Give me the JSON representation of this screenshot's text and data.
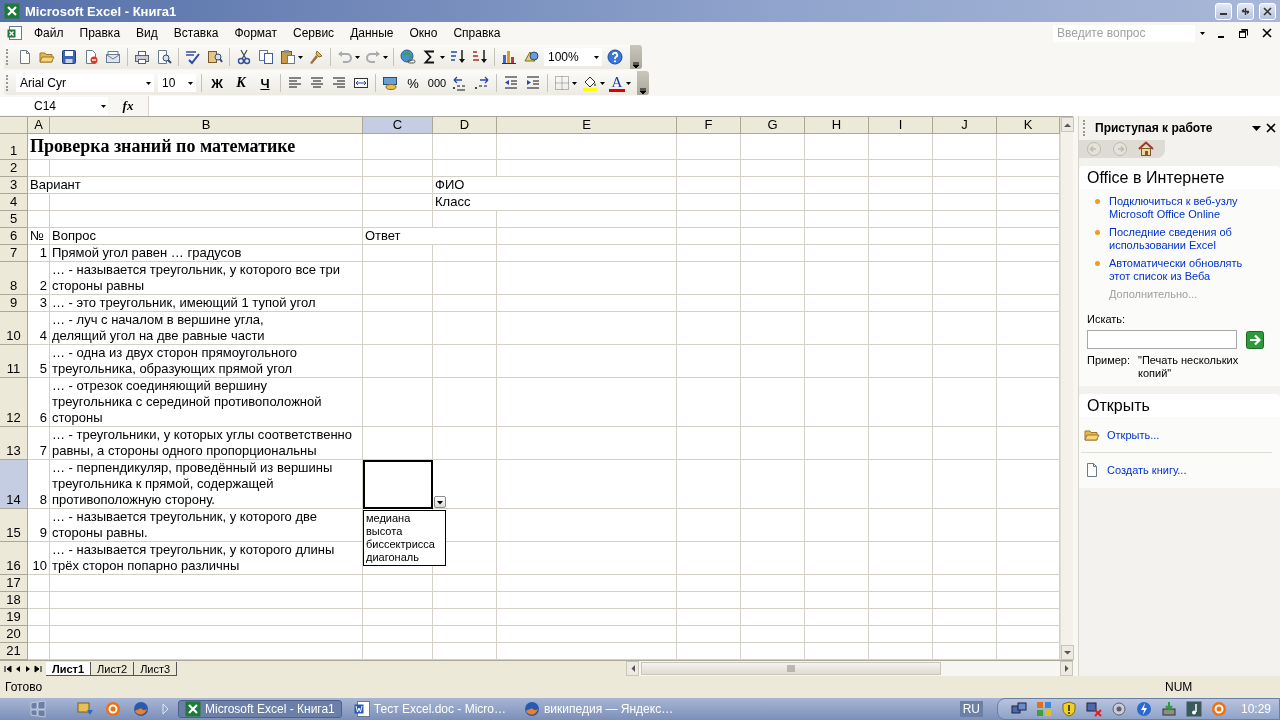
{
  "window": {
    "title": "Microsoft Excel - Книга1"
  },
  "menu": [
    "Файл",
    "Правка",
    "Вид",
    "Вставка",
    "Формат",
    "Сервис",
    "Данные",
    "Окно",
    "Справка"
  ],
  "help_box": {
    "placeholder": "Введите вопрос"
  },
  "standard_toolbar": {
    "zoom": "100%"
  },
  "formatting_toolbar": {
    "font": "Arial Cyr",
    "size": "10",
    "bold": "Ж",
    "italic": "К",
    "underline": "Ч",
    "percent": "%",
    "thousands": "000",
    "font_color": "A"
  },
  "formula_bar": {
    "name_box": "C14",
    "fx": "fx"
  },
  "sheet": {
    "columns": [
      {
        "label": "A",
        "selected": false
      },
      {
        "label": "B",
        "selected": false
      },
      {
        "label": "C",
        "selected": true
      },
      {
        "label": "D",
        "selected": false
      },
      {
        "label": "E",
        "selected": false
      },
      {
        "label": "F",
        "selected": false
      },
      {
        "label": "G",
        "selected": false
      },
      {
        "label": "H",
        "selected": false
      },
      {
        "label": "I",
        "selected": false
      },
      {
        "label": "J",
        "selected": false
      },
      {
        "label": "K",
        "selected": false
      }
    ],
    "rows": [
      {
        "header": "1",
        "selected": false,
        "a": {
          "text": "Проверка знаний по математике",
          "kind": "title",
          "selected": false
        }
      },
      {
        "header": "2",
        "selected": false
      },
      {
        "header": "3",
        "selected": false,
        "a": {
          "text": "Вариант",
          "kind": "label",
          "selected": false
        },
        "d": {
          "text": "ФИО",
          "kind": "label",
          "selected": false
        }
      },
      {
        "header": "4",
        "selected": false,
        "d": {
          "text": "Класс",
          "kind": "label",
          "selected": false
        }
      },
      {
        "header": "5",
        "selected": false
      },
      {
        "header": "6",
        "selected": false,
        "a": {
          "text": "№",
          "kind": "label",
          "selected": false
        },
        "b": {
          "text": "Вопрос",
          "kind": "label",
          "selected": false
        },
        "c": {
          "text": "Ответ",
          "kind": "label",
          "selected": false
        }
      },
      {
        "header": "7",
        "selected": false,
        "a": {
          "text": "1",
          "kind": "number",
          "selected": false
        },
        "b": {
          "text": "Прямой угол равен … градусов",
          "kind": "wrap",
          "selected": false
        }
      },
      {
        "header": "8",
        "selected": false,
        "a": {
          "text": "2",
          "kind": "number",
          "selected": false
        },
        "b": {
          "text": "… - называется треугольник, у которого все три стороны равны",
          "kind": "wrap",
          "selected": false
        }
      },
      {
        "header": "9",
        "selected": false,
        "a": {
          "text": "3",
          "kind": "number",
          "selected": false
        },
        "b": {
          "text": "… - это треугольник, имеющий 1 тупой угол",
          "kind": "wrap",
          "selected": false
        }
      },
      {
        "header": "10",
        "selected": false,
        "a": {
          "text": "4",
          "kind": "number",
          "selected": false
        },
        "b": {
          "text": "… - луч с началом в вершине угла,\nделящий угол на две равные части",
          "kind": "wrap",
          "selected": false
        }
      },
      {
        "header": "11",
        "selected": false,
        "a": {
          "text": "5",
          "kind": "number",
          "selected": false
        },
        "b": {
          "text": "… - одна из двух сторон прямоугольного треугольника, образующих прямой угол",
          "kind": "wrap",
          "selected": false
        }
      },
      {
        "header": "12",
        "selected": false,
        "a": {
          "text": "6",
          "kind": "number",
          "selected": false
        },
        "b": {
          "text": "… - отрезок соединяющий вершину\nтреугольника с серединой противоположной стороны",
          "kind": "wrap",
          "selected": false
        }
      },
      {
        "header": "13",
        "selected": false,
        "a": {
          "text": "7",
          "kind": "number",
          "selected": false
        },
        "b": {
          "text": "… - треугольники, у которых углы соответственно равны, а стороны одного пропорциональны",
          "kind": "wrap",
          "selected": false
        }
      },
      {
        "header": "14",
        "selected": true,
        "a": {
          "text": "8",
          "kind": "number",
          "selected": false
        },
        "b": {
          "text": "… - перпендикуляр, проведённый из вершины треугольника к прямой, содержащей противоположную сторону.",
          "kind": "wrap",
          "selected": false
        },
        "c": {
          "kind": "input",
          "selected": true,
          "dropdown": [
            {
              "text": "медиана",
              "selected": false
            },
            {
              "text": "высота",
              "selected": false
            },
            {
              "text": "биссектрисса",
              "selected": false
            },
            {
              "text": "диагональ",
              "selected": false
            }
          ]
        }
      },
      {
        "header": "15",
        "selected": false,
        "a": {
          "text": "9",
          "kind": "number",
          "selected": false
        },
        "b": {
          "text": "… - называется треугольник, у которого две стороны равны.",
          "kind": "wrap",
          "selected": false
        }
      },
      {
        "header": "16",
        "selected": false,
        "a": {
          "text": "10",
          "kind": "number",
          "selected": false
        },
        "b": {
          "text": "… - называется треугольник, у которого длины трёх сторон попарно различны",
          "kind": "wrap",
          "selected": false
        }
      },
      {
        "header": "17",
        "selected": false
      },
      {
        "header": "18",
        "selected": false
      },
      {
        "header": "19",
        "selected": false
      },
      {
        "header": "20",
        "selected": false
      },
      {
        "header": "21",
        "selected": false
      }
    ]
  },
  "sheet_tabs": [
    {
      "label": "Лист1",
      "selected": true
    },
    {
      "label": "Лист2",
      "selected": false
    },
    {
      "label": "Лист3",
      "selected": false
    }
  ],
  "task_pane": {
    "title": "Приступая к работе",
    "online_title": "Office в Интернете",
    "links": [
      {
        "text": "Подключиться к веб-узлу Microsoft Office Online"
      },
      {
        "text": "Последние сведения об использовании Excel"
      },
      {
        "text": "Автоматически обновлять этот список из Веба"
      }
    ],
    "more_link": {
      "text": "Дополнительно...",
      "disabled": true
    },
    "search_label": "Искать:",
    "example_label": "Пример:",
    "example": "\"Печать нескольких копий\"",
    "open_title": "Открыть",
    "open_items": [
      {
        "kind": "folder",
        "text": "Открыть..."
      },
      {
        "kind": "document",
        "text": "Создать книгу..."
      }
    ]
  },
  "status_bar": {
    "text": "Готово",
    "indicator": "NUM"
  },
  "taskbar": {
    "tasks": [
      {
        "kind": "excel",
        "label": "Microsoft Excel - Книга1",
        "selected": true
      },
      {
        "kind": "word",
        "label": "Тест Excel.doc - Micro…",
        "selected": false
      },
      {
        "kind": "browser",
        "label": "википедия — Яндекс…",
        "selected": false
      }
    ],
    "language": "RU",
    "clock": "10:29"
  }
}
